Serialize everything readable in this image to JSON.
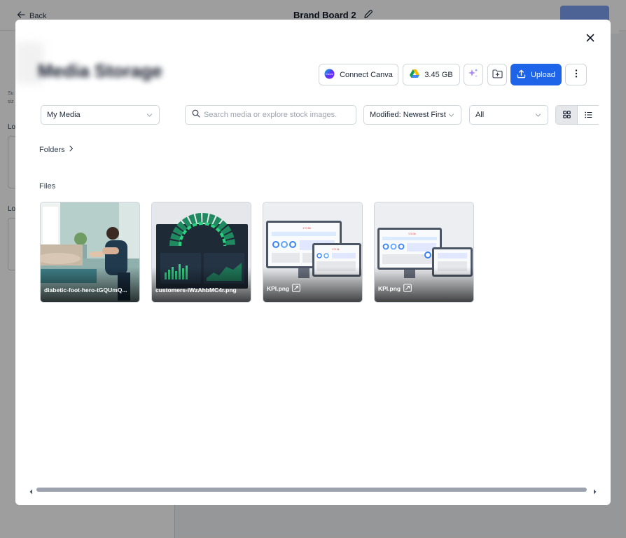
{
  "background": {
    "back_label": "Back",
    "board_title": "Brand Board 2",
    "sidebar_labels": [
      "Su",
      "siz",
      "Lo",
      "Lo"
    ]
  },
  "modal": {
    "title": "Media Storage",
    "toolbar": {
      "connect_canva_label": "Connect Canva",
      "canva_logo_text": "Canva",
      "storage_label": "3.45 GB",
      "upload_label": "Upload"
    },
    "filters": {
      "source_selected": "My Media",
      "search_placeholder": "Search media or explore stock images.",
      "sort_selected": "Modified: Newest First",
      "type_selected": "All"
    },
    "folders_label": "Folders",
    "files_label": "Files",
    "files": [
      {
        "name": "diabetic-foot-hero-tGQUmQ..."
      },
      {
        "name": "customers-iWzAhbMC4r.png"
      },
      {
        "name": "KPI.png",
        "kpi_value": "170.5k"
      },
      {
        "name": "KPI.png",
        "kpi_value": "170.5k"
      }
    ]
  },
  "colors": {
    "primary": "#1d64e8",
    "border": "#d1d5db",
    "modal_bg": "#ffffff"
  }
}
